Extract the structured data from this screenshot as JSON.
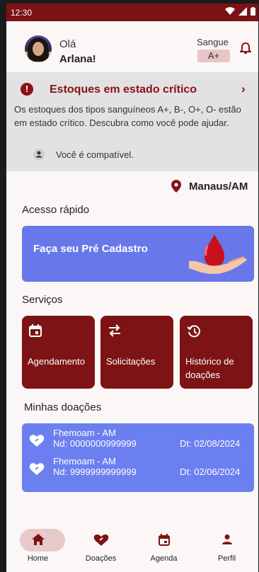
{
  "status_bar": {
    "time": "12:30"
  },
  "header": {
    "greeting": "Olá",
    "user_name": "Arlana!",
    "blood_label": "Sangue",
    "blood_type": "A+"
  },
  "alert": {
    "title": "Estoques em estado crítico",
    "message": "Os estoques dos tipos sanguíneos A+, B-, O+, O- estão em estado crítico. Descubra como você pode ajudar.",
    "compat_text": "Você é compatível."
  },
  "location": "Manaus/AM",
  "quick_access": {
    "label": "Acesso rápido",
    "card_label": "Faça seu Pré Cadastro"
  },
  "services": {
    "label": "Serviços",
    "items": [
      {
        "label": "Agendamento",
        "icon": "calendar-icon"
      },
      {
        "label": "Solicitações",
        "icon": "swap-icon"
      },
      {
        "label": "Histórico de doações",
        "icon": "history-icon"
      }
    ]
  },
  "donations": {
    "label": "Minhas doações",
    "items": [
      {
        "place": "Fhemoam - AM",
        "nd": "Nd: 0000000999999",
        "date": "Dt: 02/08/2024"
      },
      {
        "place": "Fhemoam - AM",
        "nd": "Nd: 9999999999999",
        "date": "Dt: 02/06/2024"
      }
    ]
  },
  "nav": [
    {
      "label": "Home",
      "icon": "home-icon",
      "active": true
    },
    {
      "label": "Doações",
      "icon": "heart-hand-icon",
      "active": false
    },
    {
      "label": "Agenda",
      "icon": "calendar-icon",
      "active": false
    },
    {
      "label": "Perfil",
      "icon": "person-icon",
      "active": false
    }
  ],
  "colors": {
    "primary": "#7c1214",
    "accent_blue": "#6877ea",
    "alert_bg": "#e2e2e2",
    "active_pill": "#e8c9ca"
  }
}
